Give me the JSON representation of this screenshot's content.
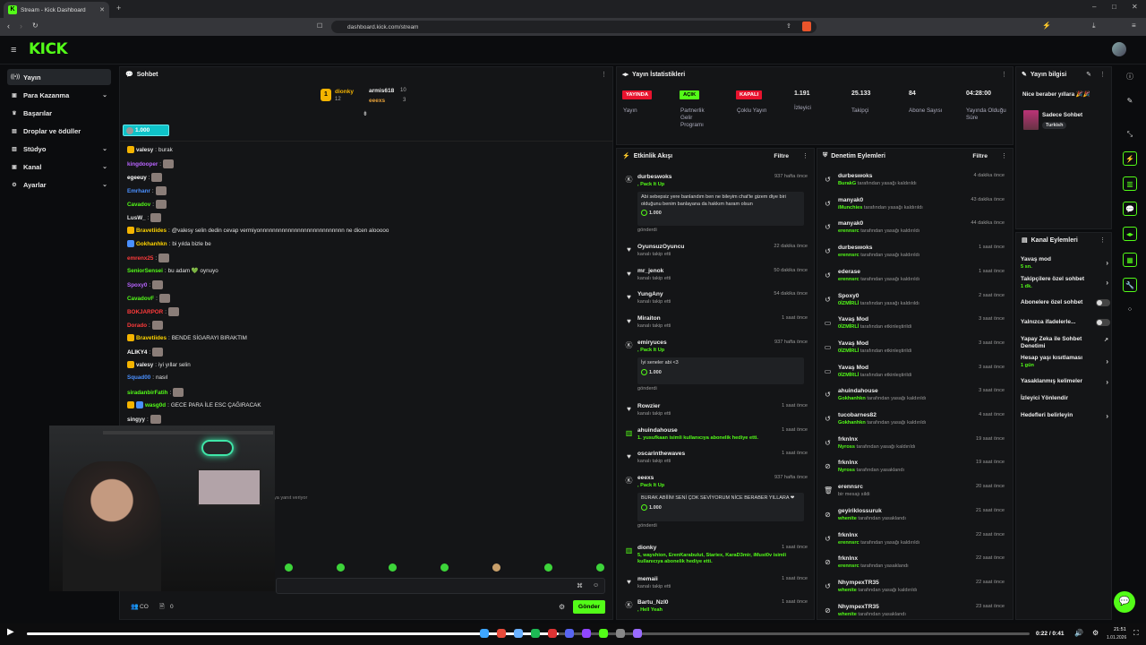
{
  "browser": {
    "tab_title": "Stream - Kick Dashboard",
    "url": "dashboard.kick.com/stream"
  },
  "header": {
    "logo": "KICK"
  },
  "sidebar": {
    "items": [
      {
        "label": "Yayın",
        "icon": "broadcast-icon",
        "active": true
      },
      {
        "label": "Para Kazanma",
        "icon": "money-icon",
        "chevron": true
      },
      {
        "label": "Başarılar",
        "icon": "trophy-icon"
      },
      {
        "label": "Droplar ve ödüller",
        "icon": "gift-icon"
      },
      {
        "label": "Stüdyo",
        "icon": "studio-icon",
        "chevron": true
      },
      {
        "label": "Kanal",
        "icon": "channel-icon",
        "chevron": true
      },
      {
        "label": "Ayarlar",
        "icon": "gear-icon",
        "chevron": true
      }
    ]
  },
  "chat": {
    "title": "Sohbet",
    "leaderboard": {
      "first": {
        "name": "dionky",
        "score": "12"
      },
      "second": {
        "name": "armis618",
        "score": "10"
      },
      "third": {
        "name": "eeexs",
        "score": "3"
      }
    },
    "goal_value": "1.000",
    "messages": [
      {
        "user": "valesy",
        "color": "#e8e8e8",
        "text": "burak"
      },
      {
        "user": "kingdooper",
        "color": "#b964ff",
        "text": ""
      },
      {
        "user": "egeeuy",
        "color": "#ffffff",
        "text": ""
      },
      {
        "user": "Emrhanr",
        "color": "#4a90ff",
        "text": ""
      },
      {
        "user": "Cavadov",
        "color": "#53fc18",
        "text": ""
      },
      {
        "user": "LusW_",
        "color": "#e8e8e8",
        "text": ""
      },
      {
        "user": "Bravetiides",
        "color": "#ffd400",
        "text": "@valesy selin dedin cevap vermiyonnnnnnnnnnnnnnnnnnnnnnnnnnn ne dicen alooooo"
      },
      {
        "user": "Gokhanhkn",
        "color": "#ffd400",
        "text": "bi yılda bizle be"
      },
      {
        "user": "emrenx25",
        "color": "#ff3b3b",
        "text": ""
      },
      {
        "user": "SeniorSensei",
        "color": "#53fc18",
        "text": "bu adam 💚 oynuyo"
      },
      {
        "user": "Spoxy0",
        "color": "#b964ff",
        "text": ""
      },
      {
        "user": "CavadovF",
        "color": "#53fc18",
        "text": ""
      },
      {
        "user": "BOKJARPOR",
        "color": "#ff3b3b",
        "text": ""
      },
      {
        "user": "Dorado",
        "color": "#ff3b3b",
        "text": ""
      },
      {
        "user": "Bravetiides",
        "color": "#ffd400",
        "text": "BENDE SİGARAYI BIRAKTIM"
      },
      {
        "user": "ALIKY4",
        "color": "#ffffff",
        "text": ""
      },
      {
        "user": "valesy",
        "color": "#e8e8e8",
        "text": "iyi yıllar selin"
      },
      {
        "user": "Squad00",
        "color": "#4a90ff",
        "text": "nasıl"
      },
      {
        "user": "siradanbirFatih",
        "color": "#53fc18",
        "text": ""
      },
      {
        "user": "wasg0d",
        "color": "#53fc18",
        "text": "GECE PARA İLE ESC ÇAĞIRACAK"
      },
      {
        "user": "singyy",
        "color": "#e8e8e8",
        "text": ""
      }
    ],
    "typing_text": "ya yanıt veriyor",
    "bottom": {
      "viewers": "CO",
      "points": "0",
      "send_label": "Gönder"
    }
  },
  "stats": {
    "title": "Yayın İstatistikleri",
    "items": [
      {
        "pill": "YAYINDA",
        "pill_color": "#e8132e",
        "label": "Yayın"
      },
      {
        "pill": "AÇIK",
        "pill_color": "#53fc18",
        "label": "Partnerlik Gelir Programı"
      },
      {
        "pill": "KAPALI",
        "pill_color": "#e8132e",
        "label": "Çoklu Yayın"
      },
      {
        "value": "1.191",
        "label": "İzleyici"
      },
      {
        "value": "25.133",
        "label": "Takipçi"
      },
      {
        "value": "84",
        "label": "Abone Sayısı"
      },
      {
        "value": "04:28:00",
        "label": "Yayında Olduğu Süre"
      }
    ]
  },
  "activity": {
    "title": "Etkinlik Akışı",
    "filter": "Filtre",
    "items": [
      {
        "name": "durbeswoks",
        "sub": ", Pack It Up",
        "green": true,
        "time": "937 hafta önce",
        "icon": "kick-icon",
        "msg": "Abi sebepsiz yere banlandım ben ne bileyim chat'te gizem diye biri olduğunu benim banlayana da hakkım haram olsun",
        "amount": "1.000",
        "sent": "gönderdi"
      },
      {
        "name": "OyunsuzOyuncu",
        "sub": "kanalı takip etti",
        "time": "22 dakika önce",
        "icon": "heart-icon"
      },
      {
        "name": "mr_jenok",
        "sub": "kanalı takip etti",
        "time": "50 dakika önce",
        "icon": "heart-icon"
      },
      {
        "name": "YungAny",
        "sub": "kanalı takip etti",
        "time": "54 dakika önce",
        "icon": "heart-icon"
      },
      {
        "name": "Miraiton",
        "sub": "kanalı takip etti",
        "time": "1 saat önce",
        "icon": "heart-icon"
      },
      {
        "name": "emiryuces",
        "sub": ", Pack It Up",
        "green": true,
        "time": "937 hafta önce",
        "icon": "kick-icon",
        "msg": "İyi seneler abi <3",
        "amount": "1.000",
        "sent": "gönderdi"
      },
      {
        "name": "Rowzier",
        "sub": "kanalı takip etti",
        "time": "1 saat önce",
        "icon": "heart-icon"
      },
      {
        "name": "ahuindahouse",
        "sub": "1. yusufkaan isimli kullanıcıya abonelik hediye etti.",
        "green": true,
        "time": "1 saat önce",
        "icon": "gift-icon"
      },
      {
        "name": "oscarinthewaves",
        "sub": "kanalı takip etti",
        "time": "1 saat önce",
        "icon": "heart-icon"
      },
      {
        "name": "eeexs",
        "sub": ", Pack It Up",
        "green": true,
        "time": "937 hafta önce",
        "icon": "kick-icon",
        "msg": "BURAK ABİİİM SENİ ÇOK SEVİYORUM NİCE BERABER YILLARA ❤",
        "amount": "1.000",
        "sent": "gönderdi"
      },
      {
        "name": "dionky",
        "sub": "5, wayshion, ErenKarabulut, Stariex, KaraD3mir, iMust0v isimli kullanıcıya abonelik hediye etti.",
        "green": true,
        "time": "1 saat önce",
        "icon": "gift-icon"
      },
      {
        "name": "memaii",
        "sub": "kanalı takip etti",
        "time": "1 saat önce",
        "icon": "heart-icon"
      },
      {
        "name": "Bartu_Nzl0",
        "sub": ", Hell Yeah",
        "green": true,
        "time": "1 saat önce",
        "icon": "kick-icon"
      }
    ]
  },
  "moderation": {
    "title": "Denetim Eylemleri",
    "filter": "Filtre",
    "items": [
      {
        "name": "durbeswoks",
        "by": "BurakG",
        "action": "tarafından yasağı kaldırıldı",
        "time": "4 dakika önce",
        "icon": "undo-icon"
      },
      {
        "name": "manyak0",
        "by": "iMunchies",
        "action": "tarafından yasağı kaldırıldı",
        "time": "43 dakika önce",
        "icon": "undo-icon"
      },
      {
        "name": "manyak0",
        "by": "erennsrc",
        "action": "tarafından yasağı kaldırıldı",
        "time": "44 dakika önce",
        "icon": "undo-icon"
      },
      {
        "name": "durbeswoks",
        "by": "erennsrc",
        "action": "tarafından yasağı kaldırıldı",
        "time": "1 saat önce",
        "icon": "undo-icon"
      },
      {
        "name": "ederase",
        "by": "erennsrc",
        "action": "tarafından yasağı kaldırıldı",
        "time": "1 saat önce",
        "icon": "undo-icon"
      },
      {
        "name": "Spoxy0",
        "by": "0İZMİRLİ",
        "action": "tarafından yasağı kaldırıldı",
        "time": "2 saat önce",
        "icon": "undo-icon"
      },
      {
        "name": "Yavaş Mod",
        "by": "0İZMİRLİ",
        "action": "tarafından etkinleştirildi",
        "time": "3 saat önce",
        "icon": "chat-icon"
      },
      {
        "name": "Yavaş Mod",
        "by": "0İZMİRLİ",
        "action": "tarafından etkinleştirildi",
        "time": "3 saat önce",
        "icon": "chat-icon"
      },
      {
        "name": "Yavaş Mod",
        "by": "0İZMİRLİ",
        "action": "tarafından etkinleştirildi",
        "time": "3 saat önce",
        "icon": "chat-icon"
      },
      {
        "name": "ahuindahouse",
        "by": "Gokhanhkn",
        "action": "tarafından yasağı kaldırıldı",
        "time": "3 saat önce",
        "icon": "undo-icon"
      },
      {
        "name": "tucobarnes82",
        "by": "Gokhanhkn",
        "action": "tarafından yasağı kaldırıldı",
        "time": "4 saat önce",
        "icon": "undo-icon"
      },
      {
        "name": "frknlnx",
        "by": "Nyross",
        "action": "tarafından yasağı kaldırıldı",
        "time": "19 saat önce",
        "icon": "undo-icon"
      },
      {
        "name": "frknlnx",
        "by": "Nyross",
        "action": "tarafından yasaklandı",
        "time": "19 saat önce",
        "icon": "ban-icon"
      },
      {
        "name": "erennsrc",
        "by": "",
        "action": "bir mesajı sildi",
        "time": "20 saat önce",
        "icon": "trash-icon"
      },
      {
        "name": "geyiriklossuruk",
        "by": "whenite",
        "action": "tarafından yasaklandı",
        "time": "21 saat önce",
        "icon": "ban-icon"
      },
      {
        "name": "frknlnx",
        "by": "erennsrc",
        "action": "tarafından yasağı kaldırıldı",
        "time": "22 saat önce",
        "icon": "undo-icon"
      },
      {
        "name": "frknlnx",
        "by": "erennsrc",
        "action": "tarafından yasaklandı",
        "time": "22 saat önce",
        "icon": "ban-icon"
      },
      {
        "name": "NhympexTR35",
        "by": "whenite",
        "action": "tarafından yasağı kaldırıldı",
        "time": "22 saat önce",
        "icon": "undo-icon"
      },
      {
        "name": "NhympexTR35",
        "by": "whenite",
        "action": "tarafından yasaklandı",
        "time": "23 saat önce",
        "icon": "ban-icon"
      }
    ]
  },
  "stream_info": {
    "title": "Yayın bilgisi",
    "stream_title": "Nice beraber yıllara 🎉🎉",
    "category": "Sadece Sohbet",
    "language": "Turkish"
  },
  "channel_actions": {
    "title": "Kanal Eylemleri",
    "items": [
      {
        "label": "Yavaş mod",
        "sub": "5 sn.",
        "control": "arrow"
      },
      {
        "label": "Takipçilere özel sohbet",
        "sub": "1 dk.",
        "control": "arrow"
      },
      {
        "label": "Abonelere özel sohbet",
        "sub": "",
        "control": "toggle"
      },
      {
        "label": "Yalnızca ifadelerle...",
        "sub": "",
        "control": "toggle"
      },
      {
        "label": "Yapay Zeka ile Sohbet Denetimi",
        "sub": "",
        "control": "external"
      },
      {
        "label": "Hesap yaşı kısıtlaması",
        "sub": "1 gün",
        "control": "arrow"
      },
      {
        "label": "Yasaklanmış kelimeler",
        "sub": "",
        "control": "arrow"
      },
      {
        "label": "İzleyici Yönlendir",
        "sub": "",
        "control": "none"
      },
      {
        "label": "Hedefleri belirleyin",
        "sub": "",
        "control": "arrow"
      }
    ]
  },
  "player": {
    "time": "0:22 / 0:41",
    "progress": 0.53,
    "clock": "21:51",
    "date": "1.01.2026"
  },
  "colors": {
    "brand": "#53fc18",
    "live": "#e8132e"
  }
}
